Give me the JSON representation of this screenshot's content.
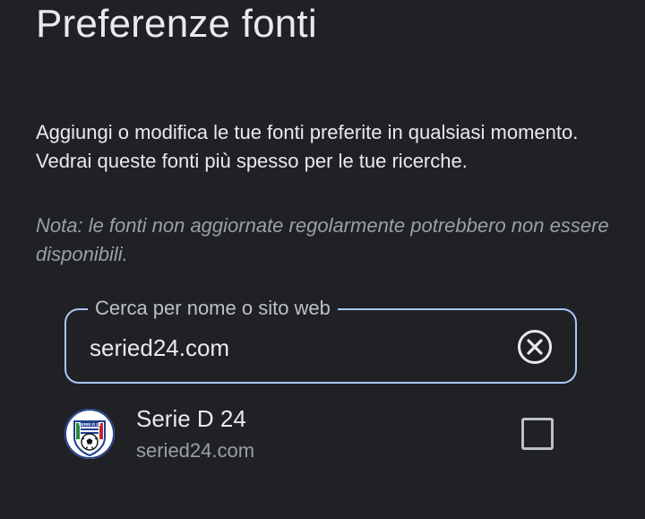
{
  "page": {
    "title": "Preferenze fonti",
    "description": "Aggiungi o modifica le tue fonti preferite in qualsiasi momento. Vedrai queste fonti più spesso per le tue ricerche.",
    "note": "Nota: le fonti non aggiornate regolarmente potrebbero non essere disponibili."
  },
  "search": {
    "label": "Cerca per nome o sito web",
    "value": "seried24.com",
    "clear_icon": "close-circle-icon"
  },
  "results": [
    {
      "name": "Serie D 24",
      "url": "seried24.com",
      "logo_text": "SERIE D 24",
      "checked": false
    }
  ],
  "colors": {
    "background": "#202124",
    "text_primary": "#e8eaed",
    "text_secondary": "#9aa0a6",
    "focus_border": "#a8c7fa"
  }
}
